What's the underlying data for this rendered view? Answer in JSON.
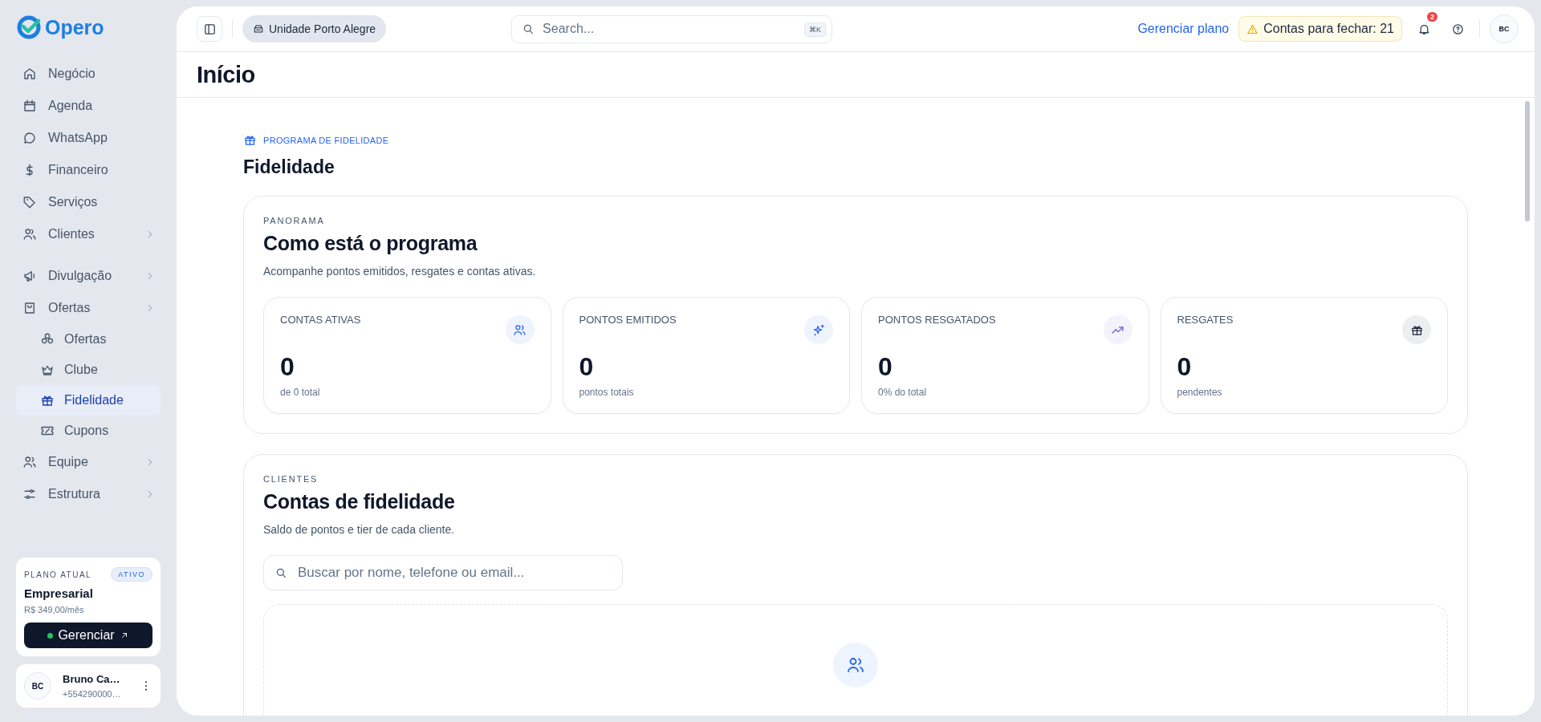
{
  "brand": "Opero",
  "nav": [
    {
      "label": "Negócio",
      "kind": "link",
      "selected": false
    },
    {
      "label": "Agenda",
      "kind": "link",
      "selected": false
    },
    {
      "label": "WhatsApp",
      "kind": "link",
      "selected": false
    },
    {
      "label": "Financeiro",
      "kind": "link",
      "selected": false
    },
    {
      "label": "Serviços",
      "kind": "link",
      "selected": false
    },
    {
      "label": "Clientes",
      "kind": "group",
      "selected": false
    },
    {
      "label": "Divulgação",
      "kind": "group",
      "selected": false
    },
    {
      "label": "Ofertas",
      "kind": "group",
      "selected": false,
      "children": [
        {
          "label": "Ofertas",
          "selected": false
        },
        {
          "label": "Clube",
          "selected": false
        },
        {
          "label": "Fidelidade",
          "selected": true
        },
        {
          "label": "Cupons",
          "selected": false
        }
      ]
    },
    {
      "label": "Equipe",
      "kind": "group",
      "selected": false
    },
    {
      "label": "Estrutura",
      "kind": "group",
      "selected": false
    }
  ],
  "plan": {
    "label": "PLANO ATUAL",
    "badge": "ATIVO",
    "name": "Empresarial",
    "price": "R$ 349,00/mês",
    "button": "Gerenciar"
  },
  "user": {
    "initials": "BC",
    "name": "Bruno Ca…",
    "phone": "+554290000…"
  },
  "topbar": {
    "unit": "Unidade Porto Alegre",
    "search": {
      "placeholder": "Search...",
      "shortcut": "⌘K"
    },
    "link": "Gerenciar plano",
    "alert": "Contas para fechar: 21",
    "notifications": "2",
    "avatar": "BC"
  },
  "page_title": "Início",
  "header": {
    "eyebrow": "PROGRAMA DE FIDELIDADE",
    "title": "Fidelidade"
  },
  "panorama": {
    "eyebrow": "PANORAMA",
    "title": "Como está o programa",
    "subtitle": "Acompanhe pontos emitidos, resgates e contas ativas.",
    "stats": [
      {
        "label": "CONTAS ATIVAS",
        "value": "0",
        "caption": "de 0 total",
        "color": "#2563eb"
      },
      {
        "label": "PONTOS EMITIDOS",
        "value": "0",
        "caption": "pontos totais",
        "color": "#2563eb"
      },
      {
        "label": "PONTOS RESGATADOS",
        "value": "0",
        "caption": "0% do total",
        "color": "#6d5bd0"
      },
      {
        "label": "RESGATES",
        "value": "0",
        "caption": "pendentes",
        "color": "#1e293b"
      }
    ]
  },
  "accounts": {
    "eyebrow": "CLIENTES",
    "title": "Contas de fidelidade",
    "subtitle": "Saldo de pontos e tier de cada cliente.",
    "search": {
      "placeholder": "Buscar por nome, telefone ou email..."
    }
  }
}
